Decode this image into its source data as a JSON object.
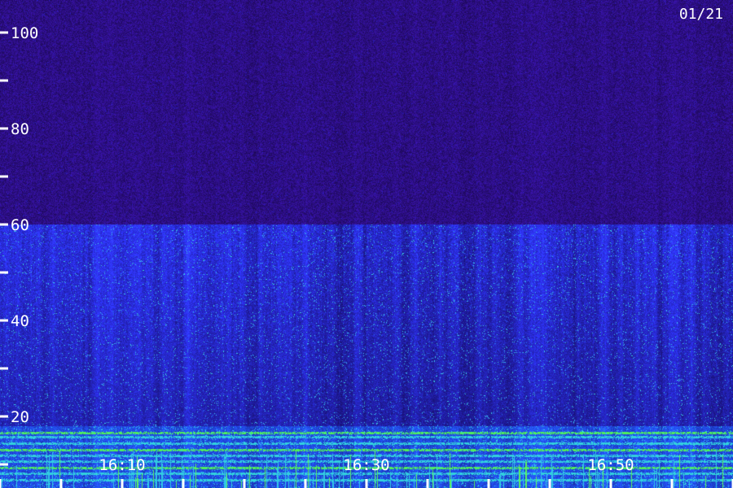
{
  "chart_data": {
    "type": "heatmap",
    "date_label": "01/21",
    "y_axis": {
      "range": [
        0,
        100
      ],
      "tick_labels": [
        "100",
        "80",
        "60",
        "40",
        "20"
      ],
      "labeled_ticks": [
        100,
        80,
        60,
        40,
        20
      ],
      "minor_ticks": [
        90,
        70,
        50,
        30,
        10
      ]
    },
    "x_axis": {
      "tick_labels": [
        "16:10",
        "16:30",
        "16:50"
      ],
      "labeled_ticks": [
        "16:10",
        "16:30",
        "16:50"
      ],
      "minor_ticks": [
        "16:00",
        "16:05",
        "16:15",
        "16:20",
        "16:25",
        "16:35",
        "16:40",
        "16:45",
        "16:55",
        "17:00"
      ]
    },
    "colors": {
      "background": "#000000",
      "low_intensity": "#1a0a4a",
      "mid_intensity": "#2a2ad0",
      "high_intensity": "#40e0d0",
      "peak_intensity": "#50ff60",
      "axis_text": "#ffffff"
    },
    "intensity_bands": [
      {
        "y_range": [
          60,
          100
        ],
        "level": "low"
      },
      {
        "y_range": [
          18,
          60
        ],
        "level": "medium"
      },
      {
        "y_range": [
          0,
          18
        ],
        "level": "high"
      }
    ],
    "grid": false
  }
}
